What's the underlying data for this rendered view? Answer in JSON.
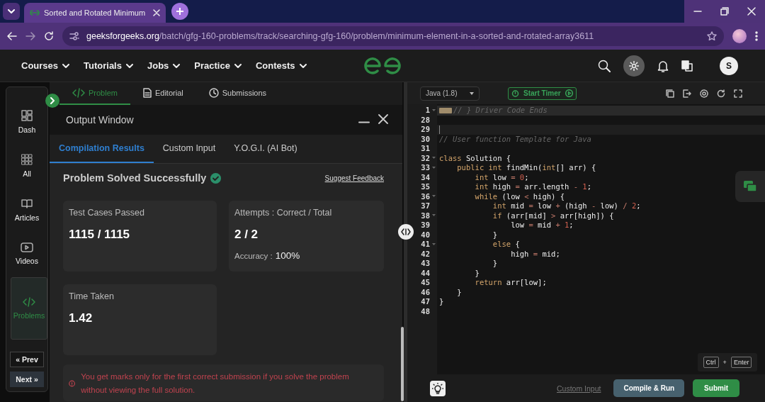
{
  "browser": {
    "tab": {
      "title": "Sorted and Rotated Minimum"
    },
    "url": {
      "domain": "geeksforgeeks.org",
      "path": "/batch/gfg-160-problems/track/searching-gfg-160/problem/minimum-element-in-a-sorted-and-rotated-array3611"
    }
  },
  "nav": {
    "items": [
      {
        "label": "Courses"
      },
      {
        "label": "Tutorials"
      },
      {
        "label": "Jobs"
      },
      {
        "label": "Practice"
      },
      {
        "label": "Contests"
      }
    ],
    "avatar": "S"
  },
  "sidebar": {
    "items": [
      {
        "label": "Dash",
        "kind": "dash",
        "selected": false
      },
      {
        "label": "All",
        "kind": "all",
        "selected": false
      },
      {
        "label": "Articles",
        "kind": "book",
        "selected": false
      },
      {
        "label": "Videos",
        "kind": "video",
        "selected": false
      },
      {
        "label": "Problems",
        "kind": "code",
        "selected": true
      }
    ],
    "prev": "« Prev",
    "next": "Next »"
  },
  "problem_tabs": [
    {
      "label": "Problem",
      "kind": "code",
      "selected": true
    },
    {
      "label": "Editorial",
      "kind": "doc",
      "selected": false
    },
    {
      "label": "Submissions",
      "kind": "clock",
      "selected": false
    }
  ],
  "output_window": {
    "title": "Output Window",
    "tabs": [
      {
        "label": "Compilation Results",
        "selected": true
      },
      {
        "label": "Custom Input",
        "selected": false
      },
      {
        "label": "Y.O.G.I. (AI Bot)",
        "selected": false
      }
    ],
    "status": "Problem Solved Successfully",
    "feedback_link": "Suggest Feedback",
    "cards": [
      {
        "label": "Test Cases Passed",
        "value": "1115 / 1115"
      },
      {
        "label": "Attempts : Correct / Total",
        "value": "2 / 2",
        "detail_label": "Accuracy :",
        "detail_value": "100%"
      },
      {
        "label": "Time Taken",
        "value": "1.42"
      }
    ],
    "notice": "You get marks only for the first correct submission if you solve the problem without viewing the full solution."
  },
  "editor": {
    "language": "Java (1.8)",
    "timer_button": "Start Timer",
    "lines": [
      {
        "num": "1",
        "kind": "folded",
        "fold": true,
        "code": [
          {
            "kind": "cm",
            "text": "// } Driver Code Ends"
          }
        ]
      },
      {
        "num": "28",
        "fold": false
      },
      {
        "num": "29",
        "fold": false,
        "current": true
      },
      {
        "num": "30",
        "fold": false,
        "code": [
          {
            "kind": "cm",
            "text": "// User function Template for Java"
          }
        ]
      },
      {
        "num": "31",
        "fold": false
      },
      {
        "num": "32",
        "fold": true,
        "code": [
          {
            "kind": "kw",
            "text": "class"
          },
          {
            "kind": "p",
            "text": " Solution {"
          }
        ]
      },
      {
        "num": "33",
        "fold": true,
        "code": [
          {
            "kind": "kw",
            "text": "    public"
          },
          {
            "kind": "kw",
            "text": " int"
          },
          {
            "kind": "p",
            "text": " findMin("
          },
          {
            "kind": "kw",
            "text": "int"
          },
          {
            "kind": "p",
            "text": "[] arr) {"
          }
        ]
      },
      {
        "num": "34",
        "fold": false,
        "code": [
          {
            "kind": "kw",
            "text": "        int"
          },
          {
            "kind": "p",
            "text": " low "
          },
          {
            "kind": "op",
            "text": "="
          },
          {
            "kind": "num",
            "text": " 0"
          },
          {
            "kind": "p",
            "text": ";"
          }
        ]
      },
      {
        "num": "35",
        "fold": false,
        "code": [
          {
            "kind": "kw",
            "text": "        int"
          },
          {
            "kind": "p",
            "text": " high "
          },
          {
            "kind": "op",
            "text": "="
          },
          {
            "kind": "p",
            "text": " arr.length "
          },
          {
            "kind": "op",
            "text": "-"
          },
          {
            "kind": "num",
            "text": " 1"
          },
          {
            "kind": "p",
            "text": ";"
          }
        ]
      },
      {
        "num": "36",
        "fold": true,
        "code": [
          {
            "kind": "kw",
            "text": "        while"
          },
          {
            "kind": "p",
            "text": " (low "
          },
          {
            "kind": "op",
            "text": "<"
          },
          {
            "kind": "p",
            "text": " high) {"
          }
        ]
      },
      {
        "num": "37",
        "fold": false,
        "code": [
          {
            "kind": "kw",
            "text": "            int"
          },
          {
            "kind": "p",
            "text": " mid "
          },
          {
            "kind": "op",
            "text": "="
          },
          {
            "kind": "p",
            "text": " low "
          },
          {
            "kind": "op",
            "text": "+"
          },
          {
            "kind": "p",
            "text": " (high "
          },
          {
            "kind": "op",
            "text": "-"
          },
          {
            "kind": "p",
            "text": " low) "
          },
          {
            "kind": "op",
            "text": "/"
          },
          {
            "kind": "num",
            "text": " 2"
          },
          {
            "kind": "p",
            "text": ";"
          }
        ]
      },
      {
        "num": "38",
        "fold": true,
        "code": [
          {
            "kind": "kw",
            "text": "            if"
          },
          {
            "kind": "p",
            "text": " (arr[mid] "
          },
          {
            "kind": "op",
            "text": ">"
          },
          {
            "kind": "p",
            "text": " arr[high]) {"
          }
        ]
      },
      {
        "num": "39",
        "fold": false,
        "code": [
          {
            "kind": "p",
            "text": "                low "
          },
          {
            "kind": "op",
            "text": "="
          },
          {
            "kind": "p",
            "text": " mid "
          },
          {
            "kind": "op",
            "text": "+"
          },
          {
            "kind": "num",
            "text": " 1"
          },
          {
            "kind": "p",
            "text": ";"
          }
        ]
      },
      {
        "num": "40",
        "fold": false,
        "code": [
          {
            "kind": "p",
            "text": "            }"
          }
        ]
      },
      {
        "num": "41",
        "fold": true,
        "code": [
          {
            "kind": "kw",
            "text": "            else"
          },
          {
            "kind": "p",
            "text": " {"
          }
        ]
      },
      {
        "num": "42",
        "fold": false,
        "code": [
          {
            "kind": "p",
            "text": "                high "
          },
          {
            "kind": "op",
            "text": "="
          },
          {
            "kind": "p",
            "text": " mid;"
          }
        ]
      },
      {
        "num": "43",
        "fold": false,
        "code": [
          {
            "kind": "p",
            "text": "            }"
          }
        ]
      },
      {
        "num": "44",
        "fold": false,
        "code": [
          {
            "kind": "p",
            "text": "        }"
          }
        ]
      },
      {
        "num": "45",
        "fold": false,
        "code": [
          {
            "kind": "kw",
            "text": "        return"
          },
          {
            "kind": "p",
            "text": " arr[low];"
          }
        ]
      },
      {
        "num": "46",
        "fold": false,
        "code": [
          {
            "kind": "p",
            "text": "    }"
          }
        ]
      },
      {
        "num": "47",
        "fold": false,
        "code": [
          {
            "kind": "p",
            "text": "}"
          }
        ]
      },
      {
        "num": "48",
        "fold": false
      }
    ],
    "shortcut": {
      "keys": [
        "Ctrl",
        "Enter"
      ],
      "joiner": "+"
    },
    "custom_input_link": "Custom Input",
    "compile_button": "Compile & Run",
    "submit_button": "Submit"
  }
}
